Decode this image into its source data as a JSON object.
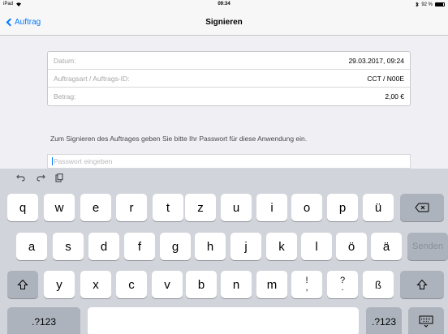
{
  "status": {
    "device": "iPad",
    "time": "09:34",
    "battery": "92 %"
  },
  "nav": {
    "back_label": "Auftrag",
    "title": "Signieren"
  },
  "details": [
    {
      "label": "Datum:",
      "value": "29.03.2017, 09:24"
    },
    {
      "label": "Auftragsart / Auftrags-ID:",
      "value": "CCT / N00E"
    },
    {
      "label": "Betrag:",
      "value": "2,00 €"
    }
  ],
  "instruction": "Zum Signieren des Auftrages geben Sie bitte Ihr Passwort für diese Anwendung ein.",
  "password": {
    "value": "",
    "placeholder": "Passwort eingeben"
  },
  "keyboard": {
    "row1": [
      "q",
      "w",
      "e",
      "r",
      "t",
      "z",
      "u",
      "i",
      "o",
      "p",
      "ü"
    ],
    "row2": [
      "a",
      "s",
      "d",
      "f",
      "g",
      "h",
      "j",
      "k",
      "l",
      "ö",
      "ä"
    ],
    "row3": [
      "y",
      "x",
      "c",
      "v",
      "b",
      "n",
      "m"
    ],
    "punct1": [
      "!",
      ","
    ],
    "punct2": [
      "?",
      "."
    ],
    "eszett": "ß",
    "send": "Senden",
    "numbers": ".?123"
  }
}
